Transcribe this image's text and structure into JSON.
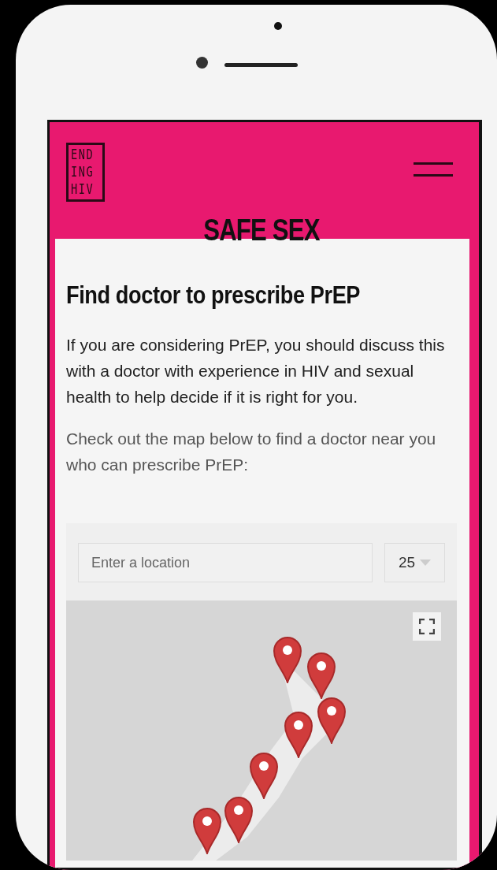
{
  "header": {
    "logo_rows": [
      "END",
      "ING",
      "HIV"
    ]
  },
  "section_title": "SAFE SEX",
  "heading": "Find doctor to prescribe PrEP",
  "paragraphs": [
    "If you are considering PrEP, you should discuss this with a doctor with experience in HIV and sexual health to help decide if it is right for you.",
    "Check out the map below to find a doctor near you who can prescribe PrEP:"
  ],
  "locator": {
    "search": {
      "placeholder": "Enter a location"
    },
    "radius": "25"
  }
}
